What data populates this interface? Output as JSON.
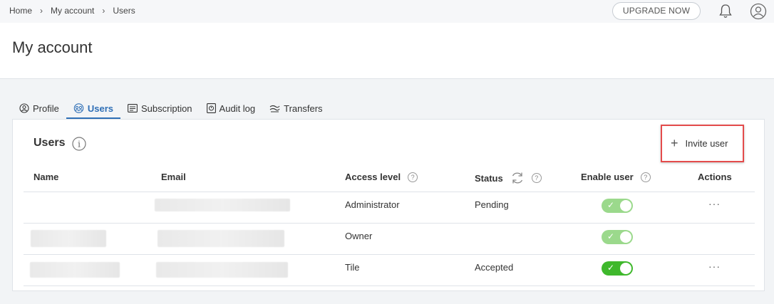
{
  "breadcrumb": [
    "Home",
    "My account",
    "Users"
  ],
  "topbar": {
    "upgrade_label": "UPGRADE NOW"
  },
  "header": {
    "title": "My account"
  },
  "tabs": [
    {
      "label": "Profile",
      "icon": "user-circle-icon"
    },
    {
      "label": "Users",
      "icon": "users-icon",
      "active": true
    },
    {
      "label": "Subscription",
      "icon": "list-box-icon"
    },
    {
      "label": "Audit log",
      "icon": "audit-log-icon"
    },
    {
      "label": "Transfers",
      "icon": "transfers-icon"
    }
  ],
  "panel": {
    "title": "Users",
    "invite_label": "Invite user"
  },
  "table": {
    "columns": [
      "Name",
      "Email",
      "Access level",
      "Status",
      "Enable user",
      "Actions"
    ],
    "rows": [
      {
        "access": "Administrator",
        "status": "Pending",
        "enabled": true,
        "toggle_style": "light",
        "actions": "···"
      },
      {
        "access": "Owner",
        "status": "",
        "enabled": true,
        "toggle_style": "light",
        "actions": ""
      },
      {
        "access": "Tile",
        "status": "Accepted",
        "enabled": true,
        "toggle_style": "dark",
        "actions": "···"
      }
    ]
  },
  "colors": {
    "accent": "#2f6fb6",
    "toggle_on": "#3fb82c",
    "toggle_disabled": "#9bd98c",
    "highlight": "#e44b4b"
  }
}
